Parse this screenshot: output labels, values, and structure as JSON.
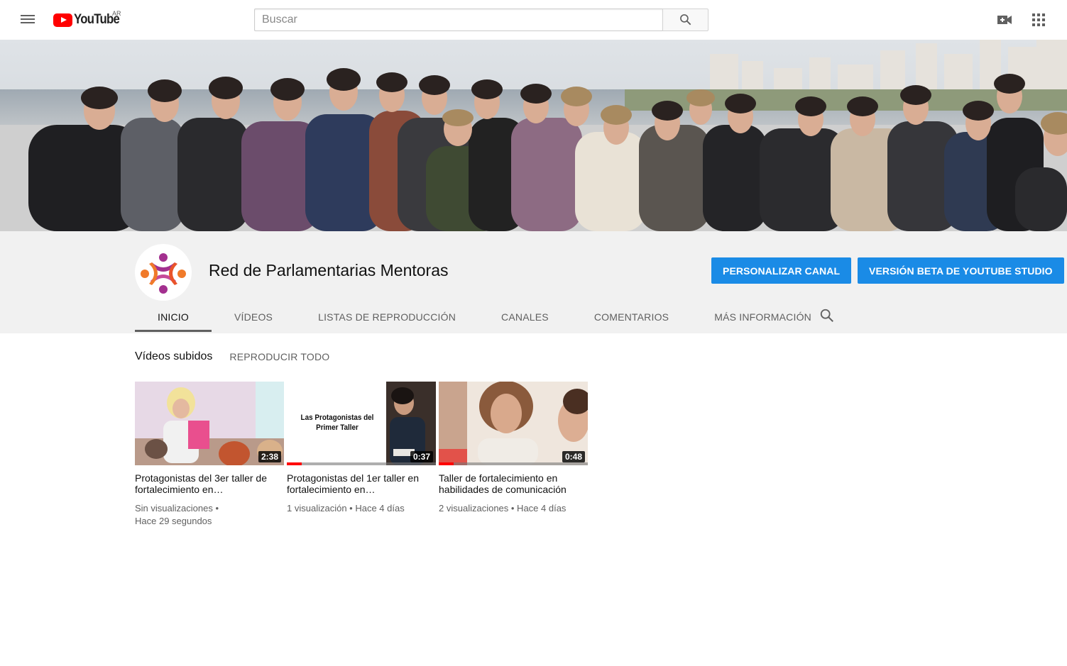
{
  "masthead": {
    "logo_text": "YouTube",
    "country": "AR",
    "search_placeholder": "Buscar"
  },
  "channel": {
    "name": "Red de Parlamentarias Mentoras",
    "customize_label": "PERSONALIZAR CANAL",
    "studio_label": "VERSIÓN BETA DE YOUTUBE STUDIO"
  },
  "tabs": [
    {
      "label": "INICIO"
    },
    {
      "label": "VÍDEOS"
    },
    {
      "label": "LISTAS DE REPRODUCCIÓN"
    },
    {
      "label": "CANALES"
    },
    {
      "label": "COMENTARIOS"
    },
    {
      "label": "MÁS INFORMACIÓN"
    }
  ],
  "section": {
    "title": "Vídeos subidos",
    "play_all": "REPRODUCIR TODO"
  },
  "videos": [
    {
      "title": "Protagonistas del 3er taller de fortalecimiento en…",
      "duration": "2:38",
      "views": "Sin visualizaciones •",
      "age": "Hace 29 segundos",
      "thumb_text": "",
      "progress": 0
    },
    {
      "title": "Protagonistas del 1er taller en fortalecimiento en…",
      "duration": "0:37",
      "views": "1 visualización • Hace 4 días",
      "age": "",
      "thumb_text": "Las Protagonistas del Primer Taller",
      "progress": 0.1
    },
    {
      "title": "Taller de fortalecimiento en habilidades de comunicación",
      "duration": "0:48",
      "views": "2 visualizaciones • Hace 4 días",
      "age": "",
      "thumb_text": "",
      "progress": 0.1
    }
  ],
  "colors": {
    "accent_blue": "#1a8be6",
    "youtube_red": "#ff0000",
    "header_bg": "#f1f1f1"
  }
}
